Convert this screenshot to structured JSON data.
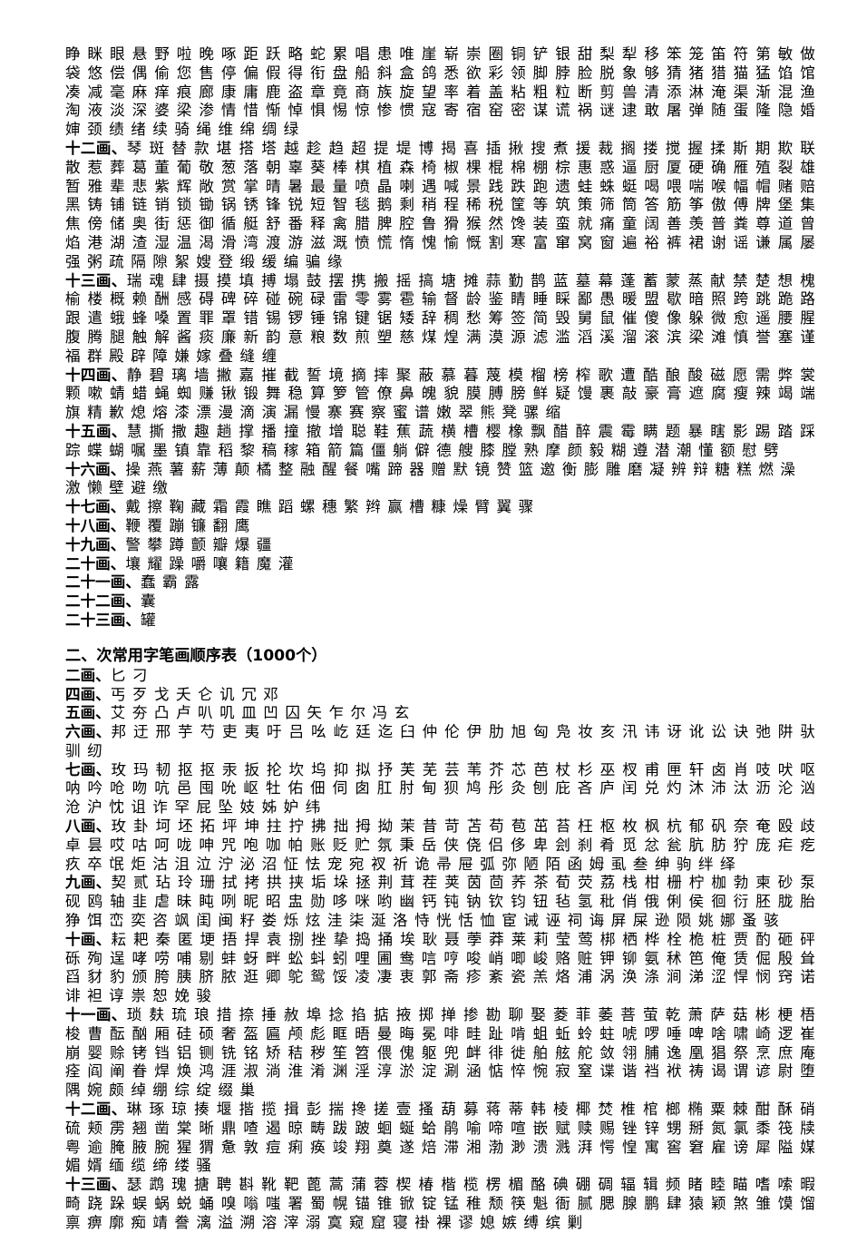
{
  "document": {
    "section_common": {
      "groups": [
        {
          "label": "",
          "chars": "睁 眯 眼 悬 野 啦 晚 啄 距 跃 略 蛇 累 唱 患 唯 崖 崭 崇 圈 铜 铲 银 甜 梨 犁 移 笨 笼 笛 符 第 敏 做 袋 悠 偿 偶 偷 您 售 停 偏 假 得 衔 盘 船 斜 盒 鸽 悉 欲 彩 领 脚 脖 脸 脱 象 够 猜 猪 猎 猫 猛 馅 馆 凑 减 毫 麻 痒 痕 廊 康 庸 鹿 盗 章 竟 商 族 旋 望 率 着 盖 粘 粗 粒 断 剪 兽 清 添 淋 淹 渠 渐 混 渔 淘 液 淡 深 婆 梁 渗 情 惜 惭 悼 惧 惕 惊 惨 惯 寇 寄 宿 窑 密 谋 谎 祸 谜 逮 敢 屠 弹 随 蛋 隆 隐 婚 婶 颈 绩 绪 续 骑 绳 维 绵 绸 绿"
        },
        {
          "label": "十二画、",
          "chars": "琴 斑 替 款 堪 搭 塔 越 趁 趋 超 提 堤 博 揭 喜 插 揪 搜 煮 援 裁 搁 搂 搅 握 揉 斯 期 欺 联 散 惹 葬 葛 董 葡 敬 葱 落 朝 辜 葵 棒 棋 植 森 椅 椒 棵 棍 棉 棚 棕 惠 惑 逼 厨 厦 硬 确 雁 殖 裂 雄 暂 雅 辈 悲 紫 辉 敞 赏 掌 晴 暑 最 量 喷 晶 喇 遇 喊 景 践 跌 跑 遗 蛙 蛛 蜓 喝 喂 喘 喉 幅 帽 赌 赔 黑 铸 铺 链 销 锁 锄 锅 锈 锋 锐 短 智 毯 鹅 剩 稍 程 稀 税 筐 等 筑 策 筛 筒 答 筋 筝 傲 傅 牌 堡 集 焦 傍 储 奥 街 惩 御 循 艇 舒 番 释 禽 腊 脾 腔 鲁 猾 猴 然 馋 装 蛮 就 痛 童 阔 善 羡 普 粪 尊 道 曾 焰 港 湖 渣 湿 温 渴 滑 湾 渡 游 滋 溉 愤 慌 惰 愧 愉 慨 割 寒 富 窜 窝 窗 遍 裕 裤 裙 谢 谣 谦 属 屡 强 粥 疏 隔 隙 絮 嫂 登 缎 缓 编 骗 缘"
        },
        {
          "label": "十三画、",
          "chars": "瑞 魂 肆 摄 摸 填 搏 塌 鼓 摆 携 搬 摇 搞 塘 摊 蒜 勤 鹊 蓝 墓 幕 蓬 蓄 蒙 蒸 献 禁 楚 想 槐 榆 楼 概 赖 酬 感 碍 碑 碎 碰 碗 碌 雷 零 雾 雹 输 督 龄 鉴 睛 睡 睬 鄙 愚 暖 盟 歇 暗 照 跨 跳 跪 路 跟 遣 蛾 蜂 嗓 置 罪 罩 错 锡 锣 锤 锦 键 锯 矮 辞 稠 愁 筹 签 简 毁 舅 鼠 催 傻 像 躲 微 愈 遥 腰 腥 腹 腾 腿 触 解 酱 痰 廉 新 韵 意 粮 数 煎 塑 慈 煤 煌 满 漠 源 滤 滥 滔 溪 溜 滚 滨 梁 滩 慎 誉 塞 谨 福 群 殿 辟 障 嫌 嫁 叠 缝 缠"
        },
        {
          "label": "十四画、",
          "chars": "静 碧 璃 墙 撇 嘉 摧 截 誓 境 摘 摔 聚 蔽 慕 暮 蔑 模 榴 榜 榨 歌 遭 酷 酿 酸 磁 愿 需 弊 裳 颗 嗽 蜻 蜡 蝇 蜘 赚 锹 锻 舞 稳 算 箩 管 僚 鼻 魄 貌 膜 膊 膀 鲜 疑 馒 裹 敲 豪 膏 遮 腐 瘦 辣 竭 端 旗 精 歉 熄 熔 漆 漂 漫 滴 演 漏 慢 寨 赛 察 蜜 谱 嫩 翠 熊 凳 骡 缩"
        },
        {
          "label": "十五画、",
          "chars": "慧 撕 撒 趣 趟 撑 播 撞 撤 增 聪 鞋 蕉 蔬 横 槽 樱 橡 飘 醋 醉 震 霉 瞒 题 暴 瞎 影 踢 踏 踩 踪 蝶 蝴 嘱 墨 镇 靠 稻 黎 稿 稼 箱 箭 篇 僵 躺 僻 德 艘 膝 膛 熟 摩 颜 毅 糊 遵 潜 潮 懂 额 慰 劈"
        },
        {
          "label": "十六画、",
          "chars": "操 燕 薯 薪 薄 颠 橘 整 融 醒 餐 嘴 蹄 器 赠 默 镜 赞 篮 邀 衡 膨 雕 磨 凝 辨 辩 糖 糕 燃 澡 激 懒 壁 避 缴"
        },
        {
          "label": "十七画、",
          "chars": "戴 擦 鞠 藏 霜 霞 瞧 蹈 螺 穗 繁 辫 赢 槽 糠 燥 臂 翼 骤"
        },
        {
          "label": "十八画、",
          "chars": "鞭 覆 蹦 镰 翻 鹰"
        },
        {
          "label": "十九画、",
          "chars": "警 攀 蹲 颤 瓣 爆 疆"
        },
        {
          "label": "二十画、",
          "chars": "壤 耀 躁 嚼 嚷 籍 魔 灌"
        },
        {
          "label": "二十一画、",
          "chars": "蠢 霸 露"
        },
        {
          "label": "二十二画、",
          "chars": "囊"
        },
        {
          "label": "二十三画、",
          "chars": "罐"
        }
      ]
    },
    "section_secondary": {
      "title_prefix": "二、次常用字笔画顺序表（",
      "title_count": "1000",
      "title_suffix": "个）",
      "groups": [
        {
          "label": "二画、",
          "chars": "匕 刁"
        },
        {
          "label": "四画、",
          "chars": "丐 歹 戈 夭 仑 讥 冗 邓"
        },
        {
          "label": "五画、",
          "chars": "艾 夯 凸 卢 叭 叽 皿 凹 囚 矢 乍 尔 冯 玄"
        },
        {
          "label": "六画、",
          "chars": "邦 迂 邢 芋 芍 吏 夷 吁 吕 吆 屹 廷 迄 臼 仲 伦 伊 肋 旭 匈 凫 妆 亥 汛 讳 讶 讹 讼 诀 弛 阱 驮 驯 纫"
        },
        {
          "label": "七画、",
          "chars": "玫 玛 韧 抠 抠 汞 扳 抡 坎 坞 抑 拟 抒 芙 芜 芸 苇 芥 芯 芭 杖 杉 巫 杈 甫 匣 轩 卤 肖 吱 吠 呕 呐 吟 呛 吻 吭 邑 囤 吮 岖 牡 佑 佃 伺 囱 肛 肘 甸 狈 鸠 彤 灸 刨 庇 吝 庐 闰 兑 灼 沐 沛 汰 沥 沦 汹 沧 沪 忱 诅 诈 罕 屁 坠 妓 姊 妒 纬"
        },
        {
          "label": "八画、",
          "chars": "玫 卦 坷 坯 拓 坪 坤 拄 拧 拂 拙 拇 拗 茉 昔 苛 苫 苟 苞 茁 苔 枉 枢 枚 枫 杭 郁 矾 奈 奄 殴 歧 卓 昙 哎 咕 呵 咙 呻 咒 咆 咖 帕 账 贬 贮 氛 秉 岳 侠 侥 侣 侈 卑 刽 刹 肴 觅 忿 瓮 肮 肪 狞 庞 疟 疙 疚 卒 氓 炬 沽 沮 泣 泞 泌 沼 怔 怯 宠 宛 衩 祈 诡 帚 屉 弧 弥 陋 陌 函 姆 虱 叁 绅 驹 绊 绎"
        },
        {
          "label": "九画、",
          "chars": "契 贰 玷 玲 珊 拭 拷 拱 挟 垢 垛 拯 荆 茸 茬 荚 茵 茴 荞 茶 荀 荧 荔 栈 柑 栅 柠 枷 勃 柬 砂 泵 砚 鸥 轴 韭 虐 昧 盹 咧 昵 昭 盅 勋 哆 咪 哟 幽 钙 钝 钠 钦 钧 钮 毡 氢 秕 俏 俄 俐 侯 徊 衍 胚 胧 胎 狰 饵 峦 奕 咨 飒 闺 闽 籽 娄 烁 炫 洼 柒 涎 洛 恃 恍 恬 恤 宦 诫 诬 祠 诲 屏 屎 逊 陨 姚 娜 蚤 骇"
        },
        {
          "label": "十画、",
          "chars": "耘 耙 秦 匿 埂 捂 捍 袁 捌 挫 挚 捣 捅 埃 耿 聂 荸 莽 莱 莉 莹 莺 梆 栖 桦 栓 桅 桩 贾 酌 砸 砰 砾 殉 逞 哮 唠 哺 剔 蚌 蚜 畔 蚣 蚪 蚓 哩 圃 鸯 唁 哼 唆 峭 唧 峻 赂 赃 钾 铆 氨 秫 笆 俺 赁 倔 殷 耸 舀 豺 豹 颁 胯 胰 脐 脓 逛 卿 鸵 鸳 馁 凌 凄 衷 郭 斋 疹 紊 瓷 羔 烙 浦 涡 涣 涤 涧 涕 涩 悍 悯 窍 诺 诽 袒 谆 祟 恕 娩 骏"
        },
        {
          "label": "十一画、",
          "chars": "琐 麸 琉 琅 措 捺 捶 赦 埠 捻 掐 掂 掖 掷 掸 掺 勘 聊 娶 菱 菲 萎 菩 萤 乾 萧 萨 菇 彬 梗 梧 梭 曹 酝 酗 厢 硅 硕 奢 盔 匾 颅 彪 眶 晤 曼 晦 冕 啡 畦 趾 啃 蛆 蚯 蛉 蛀 唬 啰 唾 啤 啥 啸 崎 逻 崔 崩 婴 赊 铐 铛 铝 铡 铣 铭 矫 秸 秽 笙 笤 偎 傀 躯 兜 衅 徘 徙 舶 舷 舵 敛 翎 脯 逸 凰 猖 祭 烹 庶 庵 痊 阎 阐 眷 焊 焕 鸿 涯 淑 淌 淮 淆 渊 淫 淳 淤 淀 涮 涵 惦 悴 惋 寂 窒 谍 谐 裆 袱 祷 谒 谓 谚 尉 堕 隅 婉 颇 绰 绷 综 绽 缀 巢"
        },
        {
          "label": "十二画、",
          "chars": "琳 琢 琼 揍 堰 揩 揽 揖 彭 揣 搀 搓 壹 搔 葫 募 蒋 蒂 韩 棱 椰 焚 椎 棺 榔 椭 粟 棘 酣 酥 硝 硫 颊 雳 翘 凿 棠 晰 鼎 喳 遏 晾 畴 跋 跛 蛔 蜒 蛤 鹃 喻 啼 喧 嵌 赋 赎 赐 锉 锌 甥 掰 氮 氯 黍 筏 牍 粤 逾 腌 腋 腕 猩 猬 惫 敦 痘 痢 痪 竣 翔 奠 遂 焙 滞 湘 渤 渺 溃 溅 湃 愕 惶 寓 窖 窘 雇 谤 犀 隘 媒 媚 婿 缅 缆 缔 缕 骚"
        },
        {
          "label": "十三画、",
          "chars": "瑟 鹉 瑰 搪 聘 斟 靴 靶 蓖 蒿 蒲 蓉 楔 椿 楷 榄 楞 楣 酪 碘 硼 碉 辐 辑 频 睹 睦 瞄 嗜 嗦 暇 畸 跷 跺 蜈 蜗 蜕 蛹 嗅 嗡 嗤 署 蜀 幌 锚 锥 锨 锭 锰 稚 颓 筷 魁 衙 腻 腮 腺 鹏 肆 猿 颖 煞 雏 馍 馏 禀 痹 廓 痴 靖 誊 漓 溢 溯 溶 滓 溺 寞 窥 窟 寝 褂 裸 谬 媳 嫉 缚 缤 剿"
        }
      ]
    }
  }
}
